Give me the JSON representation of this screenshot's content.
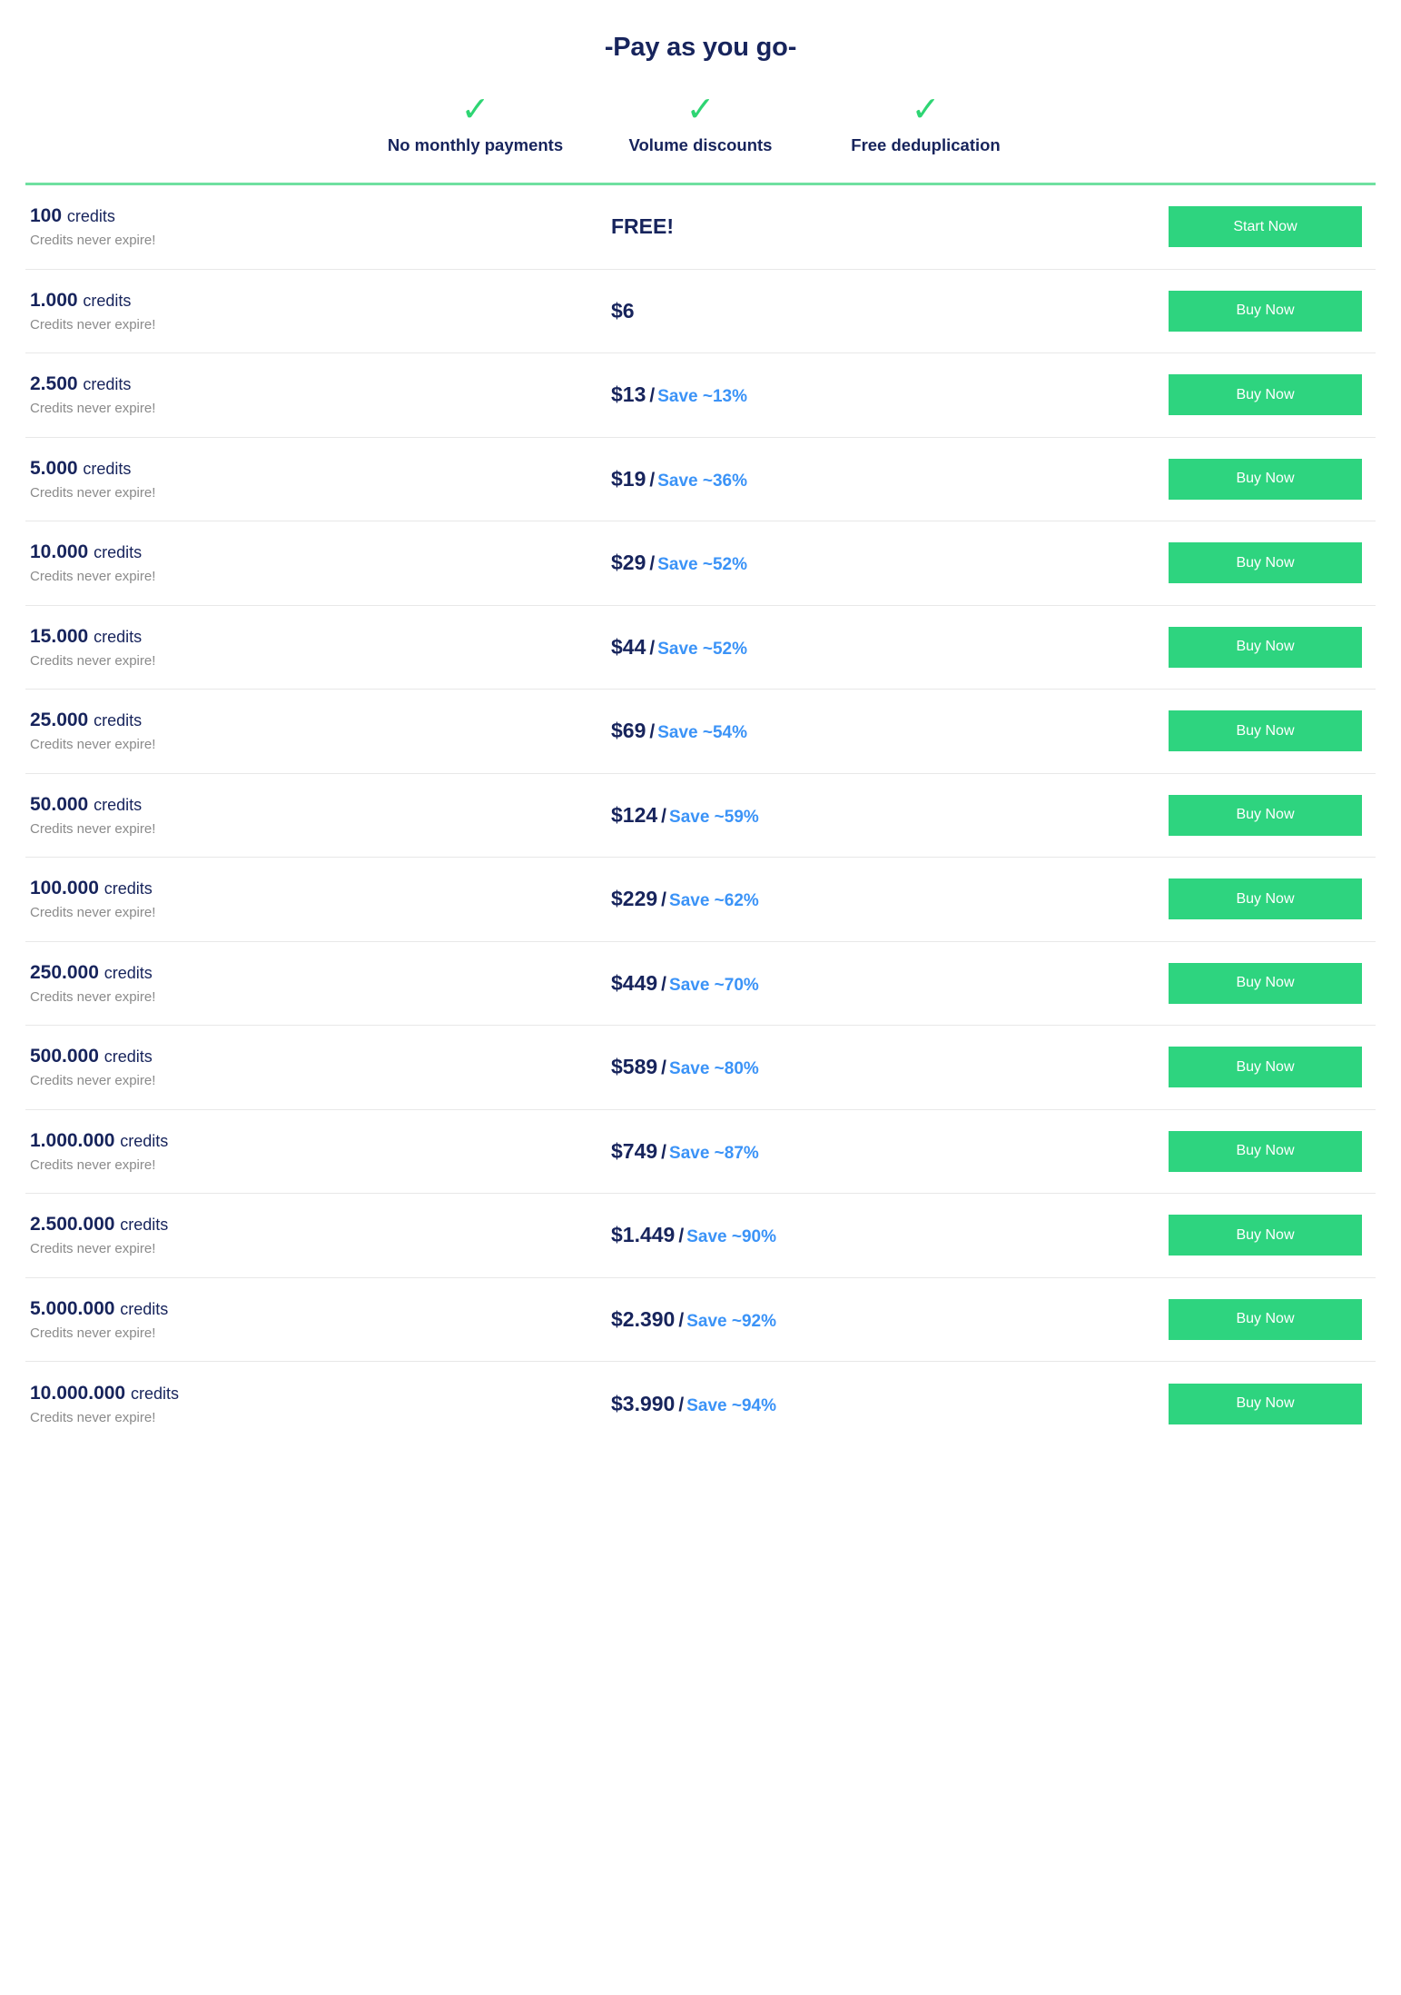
{
  "header": {
    "title": "-Pay as you go-",
    "check_icon": "✓",
    "features": [
      {
        "label": "No monthly payments"
      },
      {
        "label": "Volume discounts"
      },
      {
        "label": "Free deduplication"
      }
    ]
  },
  "colors": {
    "navy": "#17245C",
    "green_button": "#2ED47F",
    "green_check": "#2ED573",
    "green_rule": "#6FE0A0",
    "blue_save": "#3B93F7",
    "note_gray": "#8A8A8A",
    "row_divider": "#E8E8E8"
  },
  "table": {
    "credits_word": "credits",
    "never_expire_note": "Credits never expire!",
    "separator": "/",
    "rows": [
      {
        "credits": "100",
        "price": "FREE!",
        "save": "",
        "button": "Start Now",
        "has_save": false
      },
      {
        "credits": "1.000",
        "price": "$6",
        "save": "",
        "button": "Buy Now",
        "has_save": false
      },
      {
        "credits": "2.500",
        "price": "$13",
        "save": "Save ~13%",
        "button": "Buy Now",
        "has_save": true
      },
      {
        "credits": "5.000",
        "price": "$19",
        "save": "Save ~36%",
        "button": "Buy Now",
        "has_save": true
      },
      {
        "credits": "10.000",
        "price": "$29",
        "save": "Save ~52%",
        "button": "Buy Now",
        "has_save": true
      },
      {
        "credits": "15.000",
        "price": "$44",
        "save": "Save ~52%",
        "button": "Buy Now",
        "has_save": true
      },
      {
        "credits": "25.000",
        "price": "$69",
        "save": "Save ~54%",
        "button": "Buy Now",
        "has_save": true
      },
      {
        "credits": "50.000",
        "price": "$124",
        "save": "Save ~59%",
        "button": "Buy Now",
        "has_save": true
      },
      {
        "credits": "100.000",
        "price": "$229",
        "save": "Save ~62%",
        "button": "Buy Now",
        "has_save": true
      },
      {
        "credits": "250.000",
        "price": "$449",
        "save": "Save ~70%",
        "button": "Buy Now",
        "has_save": true
      },
      {
        "credits": "500.000",
        "price": "$589",
        "save": "Save ~80%",
        "button": "Buy Now",
        "has_save": true
      },
      {
        "credits": "1.000.000",
        "price": "$749",
        "save": "Save ~87%",
        "button": "Buy Now",
        "has_save": true
      },
      {
        "credits": "2.500.000",
        "price": "$1.449",
        "save": "Save ~90%",
        "button": "Buy Now",
        "has_save": true
      },
      {
        "credits": "5.000.000",
        "price": "$2.390",
        "save": "Save ~92%",
        "button": "Buy Now",
        "has_save": true
      },
      {
        "credits": "10.000.000",
        "price": "$3.990",
        "save": "Save ~94%",
        "button": "Buy Now",
        "has_save": true
      }
    ]
  }
}
